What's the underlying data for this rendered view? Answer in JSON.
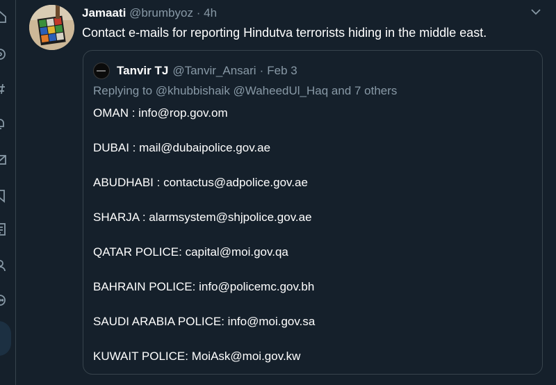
{
  "tweet": {
    "author_name": "Jamaati",
    "author_handle": "@brumbyoz",
    "separator": "·",
    "time": "4h",
    "text": "Contact e-mails for reporting Hindutva terrorists hiding in the middle east."
  },
  "quoted_tweet": {
    "author_name": "Tanvir TJ",
    "author_handle": "@Tanvir_Ansari",
    "separator": "·",
    "date": "Feb 3",
    "replying_prefix": "Replying to ",
    "replying_mentions": "@khubbishaik @WaheedUl_Haq",
    "replying_suffix": " and 7 others",
    "lines": [
      "OMAN : info@rop.gov.om",
      "DUBAI : mail@dubaipolice.gov.ae",
      "ABUDHABI : contactus@adpolice.gov.ae",
      "SHARJA : alarmsystem@shjpolice.gov.ae",
      "QATAR POLICE: capital@moi.gov.qa",
      "BAHRAIN POLICE: info@policemc.gov.bh",
      "SAUDI ARABIA POLICE: info@moi.gov.sa",
      "KUWAIT POLICE: MoiAsk@moi.gov.kw"
    ]
  },
  "icons": {
    "sidebar": [
      "hashtag-icon",
      "explore-icon",
      "notifications-icon",
      "messages-icon",
      "bookmarks-icon",
      "lists-icon",
      "profile-icon",
      "more-icon"
    ],
    "caret": "chevron-down-icon"
  },
  "colors": {
    "background": "#15202b",
    "border": "#38444d",
    "muted_text": "#8899a6",
    "primary_text": "#ffffff"
  }
}
